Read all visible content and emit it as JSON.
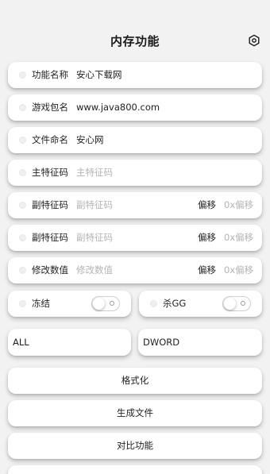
{
  "header": {
    "title": "内存功能",
    "settings_icon": "settings-hexagon-icon"
  },
  "rows": [
    {
      "label": "功能名称",
      "value": "安心下载网",
      "placeholder": ""
    },
    {
      "label": "游戏包名",
      "value": "www.java800.com",
      "placeholder": ""
    },
    {
      "label": "文件命名",
      "value": "安心网",
      "placeholder": ""
    },
    {
      "label": "主特征码",
      "value": "",
      "placeholder": "主特征码"
    },
    {
      "label": "副特征码",
      "value": "",
      "placeholder": "副特征码",
      "offset_label": "偏移",
      "offset_placeholder": "0x偏移"
    },
    {
      "label": "副特征码",
      "value": "",
      "placeholder": "副特征码",
      "offset_label": "偏移",
      "offset_placeholder": "0x偏移"
    },
    {
      "label": "修改数值",
      "value": "",
      "placeholder": "修改数值",
      "offset_label": "偏移",
      "offset_placeholder": "0x偏移"
    }
  ],
  "toggles": [
    {
      "label": "冻结",
      "on": false
    },
    {
      "label": "杀GG",
      "on": false
    }
  ],
  "selects": {
    "range": "ALL",
    "type": "DWORD"
  },
  "buttons": {
    "format": "格式化",
    "generate": "生成文件",
    "compare": "对比功能"
  }
}
